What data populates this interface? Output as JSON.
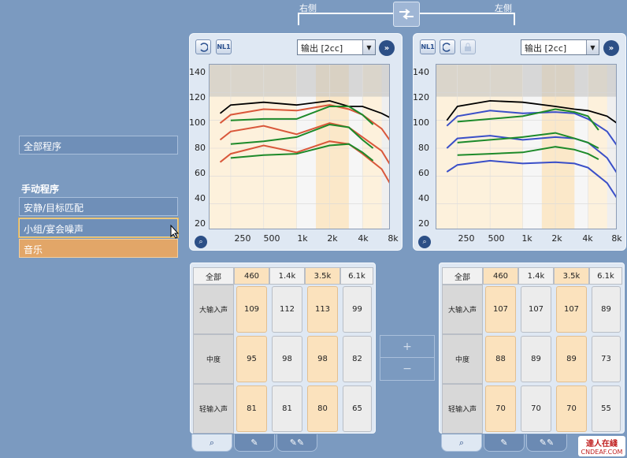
{
  "header": {
    "right_side_label": "右侧",
    "left_side_label": "左侧"
  },
  "programs": {
    "all_label": "全部程序",
    "manual_heading": "手动程序",
    "items": [
      {
        "label": "安静/目标匹配"
      },
      {
        "label": "小组/宴会噪声"
      },
      {
        "label": "音乐"
      }
    ]
  },
  "right_panel": {
    "nl_label": "NL1",
    "output_select": "输出 [2cc]",
    "y_ticks": [
      "140",
      "120",
      "100",
      "80",
      "60",
      "40",
      "20"
    ],
    "x_ticks": [
      "250",
      "500",
      "1k",
      "2k",
      "4k",
      "8k"
    ]
  },
  "left_panel": {
    "nl_label": "NL1",
    "output_select": "输出 [2cc]",
    "y_ticks": [
      "140",
      "120",
      "100",
      "80",
      "60",
      "40",
      "20"
    ],
    "x_ticks": [
      "250",
      "500",
      "1k",
      "2k",
      "4k",
      "8k"
    ]
  },
  "right_table": {
    "corner": "全部",
    "freqs": [
      "460",
      "1.4k",
      "3.5k",
      "6.1k"
    ],
    "rows": [
      {
        "label": "大输入声",
        "values": [
          "109",
          "112",
          "113",
          "99"
        ]
      },
      {
        "label": "中度",
        "values": [
          "95",
          "98",
          "98",
          "82"
        ]
      },
      {
        "label": "轻输入声",
        "values": [
          "81",
          "81",
          "80",
          "65"
        ]
      }
    ]
  },
  "left_table": {
    "corner": "全部",
    "freqs": [
      "460",
      "1.4k",
      "3.5k",
      "6.1k"
    ],
    "rows": [
      {
        "label": "大输入声",
        "values": [
          "107",
          "107",
          "107",
          "89"
        ]
      },
      {
        "label": "中度",
        "values": [
          "88",
          "89",
          "89",
          "73"
        ]
      },
      {
        "label": "轻输入声",
        "values": [
          "70",
          "70",
          "70",
          "55"
        ]
      }
    ]
  },
  "controls": {
    "plus": "+",
    "minus": "−"
  },
  "watermark": {
    "line1": "達人在綫",
    "line2": "CNDEAF.COM"
  },
  "chart_data": [
    {
      "type": "line",
      "title": "",
      "xlabel": "",
      "ylabel": "",
      "x_ticks": [
        "250",
        "500",
        "1k",
        "2k",
        "4k",
        "8k"
      ],
      "ylim": [
        20,
        140
      ],
      "series": [
        {
          "color": "#000000",
          "x": [
            "200",
            "250",
            "500",
            "1k",
            "2k",
            "3k",
            "4k",
            "6k",
            "8k"
          ],
          "values": [
            105,
            111,
            113,
            111,
            114,
            110,
            110,
            105,
            100
          ]
        },
        {
          "color": "#d9573a",
          "x": [
            "200",
            "250",
            "500",
            "1k",
            "2k",
            "3k",
            "4k",
            "6k",
            "8k"
          ],
          "values": [
            98,
            104,
            108,
            107,
            111,
            108,
            104,
            94,
            80
          ]
        },
        {
          "color": "#d9573a",
          "x": [
            "200",
            "250",
            "500",
            "1k",
            "2k",
            "3k",
            "4k",
            "6k",
            "8k"
          ],
          "values": [
            86,
            92,
            96,
            90,
            98,
            95,
            88,
            78,
            62
          ]
        },
        {
          "color": "#d9573a",
          "x": [
            "200",
            "250",
            "500",
            "1k",
            "2k",
            "3k",
            "4k",
            "6k",
            "8k"
          ],
          "values": [
            70,
            76,
            82,
            77,
            85,
            83,
            76,
            65,
            48
          ]
        },
        {
          "color": "#1d8a2a",
          "x": [
            "250",
            "500",
            "1k",
            "2k",
            "3k",
            "4k",
            "5k"
          ],
          "values": [
            100,
            101,
            101,
            110,
            110,
            104,
            97
          ]
        },
        {
          "color": "#1d8a2a",
          "x": [
            "250",
            "500",
            "1k",
            "2k",
            "3k",
            "4k",
            "5k"
          ],
          "values": [
            83,
            85,
            88,
            97,
            95,
            86,
            80
          ]
        },
        {
          "color": "#1d8a2a",
          "x": [
            "250",
            "500",
            "1k",
            "2k",
            "3k",
            "4k",
            "5k"
          ],
          "values": [
            73,
            75,
            76,
            82,
            83,
            77,
            71
          ]
        }
      ]
    },
    {
      "type": "line",
      "title": "",
      "xlabel": "",
      "ylabel": "",
      "x_ticks": [
        "250",
        "500",
        "1k",
        "2k",
        "4k",
        "8k"
      ],
      "ylim": [
        20,
        140
      ],
      "series": [
        {
          "color": "#000000",
          "x": [
            "200",
            "250",
            "500",
            "1k",
            "2k",
            "3k",
            "4k",
            "6k",
            "8k"
          ],
          "values": [
            100,
            110,
            114,
            113,
            110,
            108,
            107,
            103,
            96
          ]
        },
        {
          "color": "#3a4fc8",
          "x": [
            "200",
            "250",
            "500",
            "1k",
            "2k",
            "3k",
            "4k",
            "6k",
            "8k"
          ],
          "values": [
            96,
            103,
            107,
            105,
            106,
            105,
            101,
            92,
            78
          ]
        },
        {
          "color": "#3a4fc8",
          "x": [
            "200",
            "250",
            "500",
            "1k",
            "2k",
            "3k",
            "4k",
            "6k",
            "8k"
          ],
          "values": [
            80,
            87,
            89,
            86,
            88,
            87,
            84,
            73,
            58
          ]
        },
        {
          "color": "#3a4fc8",
          "x": [
            "200",
            "250",
            "500",
            "1k",
            "2k",
            "3k",
            "4k",
            "6k",
            "8k"
          ],
          "values": [
            63,
            68,
            71,
            69,
            70,
            69,
            66,
            55,
            40
          ]
        },
        {
          "color": "#1d8a2a",
          "x": [
            "250",
            "500",
            "1k",
            "2k",
            "3k",
            "4k",
            "5k"
          ],
          "values": [
            99,
            101,
            103,
            108,
            106,
            103,
            93
          ]
        },
        {
          "color": "#1d8a2a",
          "x": [
            "250",
            "500",
            "1k",
            "2k",
            "3k",
            "4k",
            "5k"
          ],
          "values": [
            84,
            86,
            88,
            91,
            87,
            84,
            80
          ]
        },
        {
          "color": "#1d8a2a",
          "x": [
            "250",
            "500",
            "1k",
            "2k",
            "3k",
            "4k",
            "5k"
          ],
          "values": [
            75,
            76,
            77,
            81,
            79,
            76,
            72
          ]
        }
      ]
    }
  ]
}
